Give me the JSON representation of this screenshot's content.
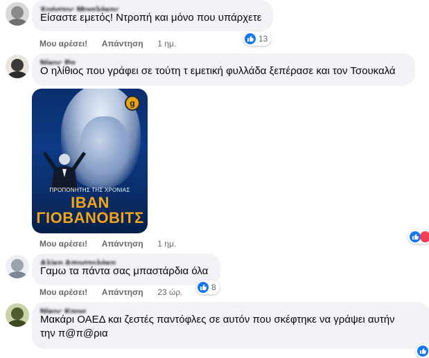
{
  "comments": [
    {
      "author": "Χρήστος Μιχαλάκης",
      "text": "Είσαστε εμετός! Ντροπή και μόνο που υπάρχετε",
      "like_label": "Μου αρέσει!",
      "reply_label": "Απάντηση",
      "time": "1 ημ.",
      "reactions": "13"
    },
    {
      "author": "Νίκος Ρα",
      "text": "Ο ηλίθιος που γράφει σε τούτη τ εμετική φυλλάδα ξεπέρασε και τον Τσουκαλά",
      "image": {
        "subtitle": "ΠΡΟΠΟΝΗΤΗΣ ΤΗΣ ΧΡΟΝΙΑΣ",
        "title_line1": "ΙΒΑΝ",
        "title_line2": "ΓΙΟΒΑΝΟΒΙΤΣ",
        "logo": "g"
      },
      "like_label": "Μου αρέσει!",
      "reply_label": "Απάντηση",
      "time": "1 ημ."
    },
    {
      "author": "Αλίκη Αποστολάκη",
      "text": "Γαμω τα πάντα σας μπαστάρδια όλα",
      "like_label": "Μου αρέσει!",
      "reply_label": "Απάντηση",
      "time": "23 ώρ.",
      "reactions": "8"
    },
    {
      "author": "Νίκος Καρα",
      "text": "Μακάρι ΟΑΕΔ και ζεστές παντόφλες σε αυτόν που σκέφτηκε να γράψει αυτήν την π@π@ρια"
    }
  ],
  "colors": {
    "bubble": "#f0f2f5",
    "like_blue": "#1877f2",
    "love_red": "#f33e58",
    "meta_gray": "#65676b",
    "poster_gold": "#f2a51a",
    "poster_blue": "#0c3a84"
  },
  "icons": [
    "avatar",
    "like-icon",
    "love-icon"
  ]
}
